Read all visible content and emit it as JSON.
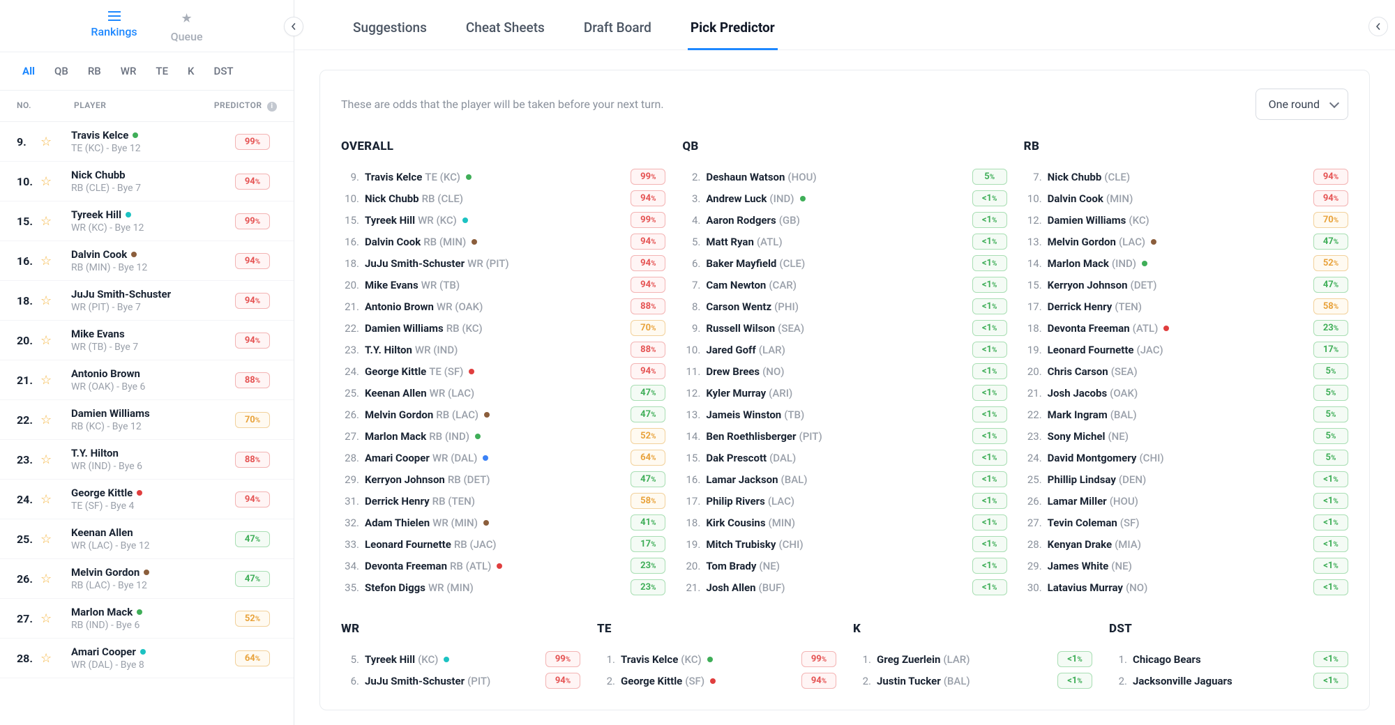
{
  "sidebar": {
    "tabs": [
      {
        "id": "rankings",
        "label": "Rankings",
        "active": true
      },
      {
        "id": "queue",
        "label": "Queue",
        "active": false
      }
    ],
    "positions": [
      "All",
      "QB",
      "RB",
      "WR",
      "TE",
      "K",
      "DST"
    ],
    "activePosition": "All",
    "headers": {
      "no": "NO.",
      "player": "PLAYER",
      "predictor": "PREDICTOR"
    },
    "players": [
      {
        "rank": "9.",
        "name": "Travis Kelce",
        "dot": "green",
        "meta": "TE (KC) - Bye 12",
        "pct": "99",
        "tier": "red"
      },
      {
        "rank": "10.",
        "name": "Nick Chubb",
        "dot": null,
        "meta": "RB (CLE) - Bye 7",
        "pct": "94",
        "tier": "red"
      },
      {
        "rank": "15.",
        "name": "Tyreek Hill",
        "dot": "teal",
        "meta": "WR (KC) - Bye 12",
        "pct": "99",
        "tier": "red"
      },
      {
        "rank": "16.",
        "name": "Dalvin Cook",
        "dot": "brown",
        "meta": "RB (MIN) - Bye 12",
        "pct": "94",
        "tier": "red"
      },
      {
        "rank": "18.",
        "name": "JuJu Smith-Schuster",
        "dot": null,
        "meta": "WR (PIT) - Bye 7",
        "pct": "94",
        "tier": "red"
      },
      {
        "rank": "20.",
        "name": "Mike Evans",
        "dot": null,
        "meta": "WR (TB) - Bye 7",
        "pct": "94",
        "tier": "red"
      },
      {
        "rank": "21.",
        "name": "Antonio Brown",
        "dot": null,
        "meta": "WR (OAK) - Bye 6",
        "pct": "88",
        "tier": "red"
      },
      {
        "rank": "22.",
        "name": "Damien Williams",
        "dot": null,
        "meta": "RB (KC) - Bye 12",
        "pct": "70",
        "tier": "orange"
      },
      {
        "rank": "23.",
        "name": "T.Y. Hilton",
        "dot": null,
        "meta": "WR (IND) - Bye 6",
        "pct": "88",
        "tier": "red"
      },
      {
        "rank": "24.",
        "name": "George Kittle",
        "dot": "red",
        "meta": "TE (SF) - Bye 4",
        "pct": "94",
        "tier": "red"
      },
      {
        "rank": "25.",
        "name": "Keenan Allen",
        "dot": null,
        "meta": "WR (LAC) - Bye 12",
        "pct": "47",
        "tier": "green"
      },
      {
        "rank": "26.",
        "name": "Melvin Gordon",
        "dot": "brown",
        "meta": "RB (LAC) - Bye 12",
        "pct": "47",
        "tier": "green"
      },
      {
        "rank": "27.",
        "name": "Marlon Mack",
        "dot": "green",
        "meta": "RB (IND) - Bye 6",
        "pct": "52",
        "tier": "orange"
      },
      {
        "rank": "28.",
        "name": "Amari Cooper",
        "dot": "teal",
        "meta": "WR (DAL) - Bye 8",
        "pct": "64",
        "tier": "orange"
      }
    ]
  },
  "main": {
    "tabs": [
      {
        "label": "Suggestions",
        "active": false
      },
      {
        "label": "Cheat Sheets",
        "active": false
      },
      {
        "label": "Draft Board",
        "active": false
      },
      {
        "label": "Pick Predictor",
        "active": true
      }
    ],
    "desc": "These are odds that the player will be taken before your next turn.",
    "roundSelect": "One round",
    "columns": {
      "OVERALL": [
        {
          "rank": "9.",
          "name": "Travis Kelce",
          "team": "TE (KC)",
          "dot": "green",
          "pct": "99",
          "tier": "red"
        },
        {
          "rank": "10.",
          "name": "Nick Chubb",
          "team": "RB (CLE)",
          "dot": null,
          "pct": "94",
          "tier": "red"
        },
        {
          "rank": "15.",
          "name": "Tyreek Hill",
          "team": "WR (KC)",
          "dot": "teal",
          "pct": "99",
          "tier": "red"
        },
        {
          "rank": "16.",
          "name": "Dalvin Cook",
          "team": "RB (MIN)",
          "dot": "brown",
          "pct": "94",
          "tier": "red"
        },
        {
          "rank": "18.",
          "name": "JuJu Smith-Schuster",
          "team": "WR (PIT)",
          "dot": null,
          "pct": "94",
          "tier": "red"
        },
        {
          "rank": "20.",
          "name": "Mike Evans",
          "team": "WR (TB)",
          "dot": null,
          "pct": "94",
          "tier": "red"
        },
        {
          "rank": "21.",
          "name": "Antonio Brown",
          "team": "WR (OAK)",
          "dot": null,
          "pct": "88",
          "tier": "red"
        },
        {
          "rank": "22.",
          "name": "Damien Williams",
          "team": "RB (KC)",
          "dot": null,
          "pct": "70",
          "tier": "orange"
        },
        {
          "rank": "23.",
          "name": "T.Y. Hilton",
          "team": "WR (IND)",
          "dot": null,
          "pct": "88",
          "tier": "red"
        },
        {
          "rank": "24.",
          "name": "George Kittle",
          "team": "TE (SF)",
          "dot": "red",
          "pct": "94",
          "tier": "red"
        },
        {
          "rank": "25.",
          "name": "Keenan Allen",
          "team": "WR (LAC)",
          "dot": null,
          "pct": "47",
          "tier": "green"
        },
        {
          "rank": "26.",
          "name": "Melvin Gordon",
          "team": "RB (LAC)",
          "dot": "brown",
          "pct": "47",
          "tier": "green"
        },
        {
          "rank": "27.",
          "name": "Marlon Mack",
          "team": "RB (IND)",
          "dot": "green",
          "pct": "52",
          "tier": "orange"
        },
        {
          "rank": "28.",
          "name": "Amari Cooper",
          "team": "WR (DAL)",
          "dot": "blue",
          "pct": "64",
          "tier": "orange"
        },
        {
          "rank": "29.",
          "name": "Kerryon Johnson",
          "team": "RB (DET)",
          "dot": null,
          "pct": "47",
          "tier": "green"
        },
        {
          "rank": "31.",
          "name": "Derrick Henry",
          "team": "RB (TEN)",
          "dot": null,
          "pct": "58",
          "tier": "orange"
        },
        {
          "rank": "32.",
          "name": "Adam Thielen",
          "team": "WR (MIN)",
          "dot": "brown",
          "pct": "41",
          "tier": "green"
        },
        {
          "rank": "33.",
          "name": "Leonard Fournette",
          "team": "RB (JAC)",
          "dot": null,
          "pct": "17",
          "tier": "green"
        },
        {
          "rank": "34.",
          "name": "Devonta Freeman",
          "team": "RB (ATL)",
          "dot": "red",
          "pct": "23",
          "tier": "green"
        },
        {
          "rank": "35.",
          "name": "Stefon Diggs",
          "team": "WR (MIN)",
          "dot": null,
          "pct": "23",
          "tier": "green"
        }
      ],
      "QB": [
        {
          "rank": "2.",
          "name": "Deshaun Watson",
          "team": "(HOU)",
          "dot": null,
          "pct": "5",
          "tier": "green"
        },
        {
          "rank": "3.",
          "name": "Andrew Luck",
          "team": "(IND)",
          "dot": "green",
          "pct": "<1",
          "tier": "green"
        },
        {
          "rank": "4.",
          "name": "Aaron Rodgers",
          "team": "(GB)",
          "dot": null,
          "pct": "<1",
          "tier": "green"
        },
        {
          "rank": "5.",
          "name": "Matt Ryan",
          "team": "(ATL)",
          "dot": null,
          "pct": "<1",
          "tier": "green"
        },
        {
          "rank": "6.",
          "name": "Baker Mayfield",
          "team": "(CLE)",
          "dot": null,
          "pct": "<1",
          "tier": "green"
        },
        {
          "rank": "7.",
          "name": "Cam Newton",
          "team": "(CAR)",
          "dot": null,
          "pct": "<1",
          "tier": "green"
        },
        {
          "rank": "8.",
          "name": "Carson Wentz",
          "team": "(PHI)",
          "dot": null,
          "pct": "<1",
          "tier": "green"
        },
        {
          "rank": "9.",
          "name": "Russell Wilson",
          "team": "(SEA)",
          "dot": null,
          "pct": "<1",
          "tier": "green"
        },
        {
          "rank": "10.",
          "name": "Jared Goff",
          "team": "(LAR)",
          "dot": null,
          "pct": "<1",
          "tier": "green"
        },
        {
          "rank": "11.",
          "name": "Drew Brees",
          "team": "(NO)",
          "dot": null,
          "pct": "<1",
          "tier": "green"
        },
        {
          "rank": "12.",
          "name": "Kyler Murray",
          "team": "(ARI)",
          "dot": null,
          "pct": "<1",
          "tier": "green"
        },
        {
          "rank": "13.",
          "name": "Jameis Winston",
          "team": "(TB)",
          "dot": null,
          "pct": "<1",
          "tier": "green"
        },
        {
          "rank": "14.",
          "name": "Ben Roethlisberger",
          "team": "(PIT)",
          "dot": null,
          "pct": "<1",
          "tier": "green"
        },
        {
          "rank": "15.",
          "name": "Dak Prescott",
          "team": "(DAL)",
          "dot": null,
          "pct": "<1",
          "tier": "green"
        },
        {
          "rank": "16.",
          "name": "Lamar Jackson",
          "team": "(BAL)",
          "dot": null,
          "pct": "<1",
          "tier": "green"
        },
        {
          "rank": "17.",
          "name": "Philip Rivers",
          "team": "(LAC)",
          "dot": null,
          "pct": "<1",
          "tier": "green"
        },
        {
          "rank": "18.",
          "name": "Kirk Cousins",
          "team": "(MIN)",
          "dot": null,
          "pct": "<1",
          "tier": "green"
        },
        {
          "rank": "19.",
          "name": "Mitch Trubisky",
          "team": "(CHI)",
          "dot": null,
          "pct": "<1",
          "tier": "green"
        },
        {
          "rank": "20.",
          "name": "Tom Brady",
          "team": "(NE)",
          "dot": null,
          "pct": "<1",
          "tier": "green"
        },
        {
          "rank": "21.",
          "name": "Josh Allen",
          "team": "(BUF)",
          "dot": null,
          "pct": "<1",
          "tier": "green"
        }
      ],
      "RB": [
        {
          "rank": "7.",
          "name": "Nick Chubb",
          "team": "(CLE)",
          "dot": null,
          "pct": "94",
          "tier": "red"
        },
        {
          "rank": "10.",
          "name": "Dalvin Cook",
          "team": "(MIN)",
          "dot": null,
          "pct": "94",
          "tier": "red"
        },
        {
          "rank": "12.",
          "name": "Damien Williams",
          "team": "(KC)",
          "dot": null,
          "pct": "70",
          "tier": "orange"
        },
        {
          "rank": "13.",
          "name": "Melvin Gordon",
          "team": "(LAC)",
          "dot": "brown",
          "pct": "47",
          "tier": "green"
        },
        {
          "rank": "14.",
          "name": "Marlon Mack",
          "team": "(IND)",
          "dot": "green",
          "pct": "52",
          "tier": "orange"
        },
        {
          "rank": "15.",
          "name": "Kerryon Johnson",
          "team": "(DET)",
          "dot": null,
          "pct": "47",
          "tier": "green"
        },
        {
          "rank": "17.",
          "name": "Derrick Henry",
          "team": "(TEN)",
          "dot": null,
          "pct": "58",
          "tier": "orange"
        },
        {
          "rank": "18.",
          "name": "Devonta Freeman",
          "team": "(ATL)",
          "dot": "red",
          "pct": "23",
          "tier": "green"
        },
        {
          "rank": "19.",
          "name": "Leonard Fournette",
          "team": "(JAC)",
          "dot": null,
          "pct": "17",
          "tier": "green"
        },
        {
          "rank": "20.",
          "name": "Chris Carson",
          "team": "(SEA)",
          "dot": null,
          "pct": "5",
          "tier": "green"
        },
        {
          "rank": "21.",
          "name": "Josh Jacobs",
          "team": "(OAK)",
          "dot": null,
          "pct": "5",
          "tier": "green"
        },
        {
          "rank": "22.",
          "name": "Mark Ingram",
          "team": "(BAL)",
          "dot": null,
          "pct": "5",
          "tier": "green"
        },
        {
          "rank": "23.",
          "name": "Sony Michel",
          "team": "(NE)",
          "dot": null,
          "pct": "5",
          "tier": "green"
        },
        {
          "rank": "24.",
          "name": "David Montgomery",
          "team": "(CHI)",
          "dot": null,
          "pct": "5",
          "tier": "green"
        },
        {
          "rank": "25.",
          "name": "Phillip Lindsay",
          "team": "(DEN)",
          "dot": null,
          "pct": "<1",
          "tier": "green"
        },
        {
          "rank": "26.",
          "name": "Lamar Miller",
          "team": "(HOU)",
          "dot": null,
          "pct": "<1",
          "tier": "green"
        },
        {
          "rank": "27.",
          "name": "Tevin Coleman",
          "team": "(SF)",
          "dot": null,
          "pct": "<1",
          "tier": "green"
        },
        {
          "rank": "28.",
          "name": "Kenyan Drake",
          "team": "(MIA)",
          "dot": null,
          "pct": "<1",
          "tier": "green"
        },
        {
          "rank": "29.",
          "name": "James White",
          "team": "(NE)",
          "dot": null,
          "pct": "<1",
          "tier": "green"
        },
        {
          "rank": "30.",
          "name": "Latavius Murray",
          "team": "(NO)",
          "dot": null,
          "pct": "<1",
          "tier": "green"
        }
      ]
    },
    "bottomColumns": {
      "WR": [
        {
          "rank": "5.",
          "name": "Tyreek Hill",
          "team": "(KC)",
          "dot": "teal",
          "pct": "99",
          "tier": "red"
        },
        {
          "rank": "6.",
          "name": "JuJu Smith-Schuster",
          "team": "(PIT)",
          "dot": null,
          "pct": "94",
          "tier": "red"
        }
      ],
      "TE": [
        {
          "rank": "1.",
          "name": "Travis Kelce",
          "team": "(KC)",
          "dot": "green",
          "pct": "99",
          "tier": "red"
        },
        {
          "rank": "2.",
          "name": "George Kittle",
          "team": "(SF)",
          "dot": "red",
          "pct": "94",
          "tier": "red"
        }
      ],
      "K": [
        {
          "rank": "1.",
          "name": "Greg Zuerlein",
          "team": "(LAR)",
          "dot": null,
          "pct": "<1",
          "tier": "green"
        },
        {
          "rank": "2.",
          "name": "Justin Tucker",
          "team": "(BAL)",
          "dot": null,
          "pct": "<1",
          "tier": "green"
        }
      ],
      "DST": [
        {
          "rank": "1.",
          "name": "Chicago Bears",
          "team": "",
          "dot": null,
          "pct": "<1",
          "tier": "green"
        },
        {
          "rank": "2.",
          "name": "Jacksonville Jaguars",
          "team": "",
          "dot": null,
          "pct": "<1",
          "tier": "green"
        }
      ]
    }
  }
}
